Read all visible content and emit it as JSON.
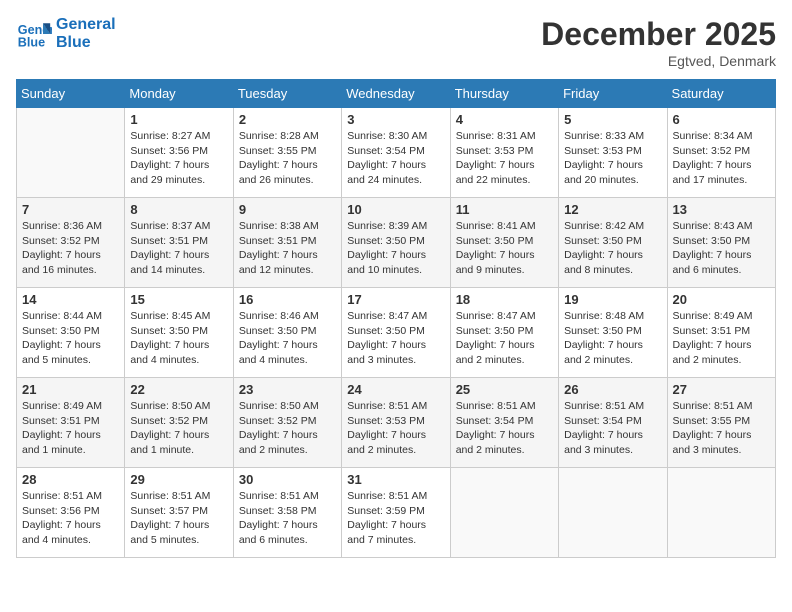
{
  "header": {
    "logo_line1": "General",
    "logo_line2": "Blue",
    "month": "December 2025",
    "location": "Egtved, Denmark"
  },
  "weekdays": [
    "Sunday",
    "Monday",
    "Tuesday",
    "Wednesday",
    "Thursday",
    "Friday",
    "Saturday"
  ],
  "weeks": [
    [
      {
        "day": "",
        "info": ""
      },
      {
        "day": "1",
        "info": "Sunrise: 8:27 AM\nSunset: 3:56 PM\nDaylight: 7 hours\nand 29 minutes."
      },
      {
        "day": "2",
        "info": "Sunrise: 8:28 AM\nSunset: 3:55 PM\nDaylight: 7 hours\nand 26 minutes."
      },
      {
        "day": "3",
        "info": "Sunrise: 8:30 AM\nSunset: 3:54 PM\nDaylight: 7 hours\nand 24 minutes."
      },
      {
        "day": "4",
        "info": "Sunrise: 8:31 AM\nSunset: 3:53 PM\nDaylight: 7 hours\nand 22 minutes."
      },
      {
        "day": "5",
        "info": "Sunrise: 8:33 AM\nSunset: 3:53 PM\nDaylight: 7 hours\nand 20 minutes."
      },
      {
        "day": "6",
        "info": "Sunrise: 8:34 AM\nSunset: 3:52 PM\nDaylight: 7 hours\nand 17 minutes."
      }
    ],
    [
      {
        "day": "7",
        "info": "Sunrise: 8:36 AM\nSunset: 3:52 PM\nDaylight: 7 hours\nand 16 minutes."
      },
      {
        "day": "8",
        "info": "Sunrise: 8:37 AM\nSunset: 3:51 PM\nDaylight: 7 hours\nand 14 minutes."
      },
      {
        "day": "9",
        "info": "Sunrise: 8:38 AM\nSunset: 3:51 PM\nDaylight: 7 hours\nand 12 minutes."
      },
      {
        "day": "10",
        "info": "Sunrise: 8:39 AM\nSunset: 3:50 PM\nDaylight: 7 hours\nand 10 minutes."
      },
      {
        "day": "11",
        "info": "Sunrise: 8:41 AM\nSunset: 3:50 PM\nDaylight: 7 hours\nand 9 minutes."
      },
      {
        "day": "12",
        "info": "Sunrise: 8:42 AM\nSunset: 3:50 PM\nDaylight: 7 hours\nand 8 minutes."
      },
      {
        "day": "13",
        "info": "Sunrise: 8:43 AM\nSunset: 3:50 PM\nDaylight: 7 hours\nand 6 minutes."
      }
    ],
    [
      {
        "day": "14",
        "info": "Sunrise: 8:44 AM\nSunset: 3:50 PM\nDaylight: 7 hours\nand 5 minutes."
      },
      {
        "day": "15",
        "info": "Sunrise: 8:45 AM\nSunset: 3:50 PM\nDaylight: 7 hours\nand 4 minutes."
      },
      {
        "day": "16",
        "info": "Sunrise: 8:46 AM\nSunset: 3:50 PM\nDaylight: 7 hours\nand 4 minutes."
      },
      {
        "day": "17",
        "info": "Sunrise: 8:47 AM\nSunset: 3:50 PM\nDaylight: 7 hours\nand 3 minutes."
      },
      {
        "day": "18",
        "info": "Sunrise: 8:47 AM\nSunset: 3:50 PM\nDaylight: 7 hours\nand 2 minutes."
      },
      {
        "day": "19",
        "info": "Sunrise: 8:48 AM\nSunset: 3:50 PM\nDaylight: 7 hours\nand 2 minutes."
      },
      {
        "day": "20",
        "info": "Sunrise: 8:49 AM\nSunset: 3:51 PM\nDaylight: 7 hours\nand 2 minutes."
      }
    ],
    [
      {
        "day": "21",
        "info": "Sunrise: 8:49 AM\nSunset: 3:51 PM\nDaylight: 7 hours\nand 1 minute."
      },
      {
        "day": "22",
        "info": "Sunrise: 8:50 AM\nSunset: 3:52 PM\nDaylight: 7 hours\nand 1 minute."
      },
      {
        "day": "23",
        "info": "Sunrise: 8:50 AM\nSunset: 3:52 PM\nDaylight: 7 hours\nand 2 minutes."
      },
      {
        "day": "24",
        "info": "Sunrise: 8:51 AM\nSunset: 3:53 PM\nDaylight: 7 hours\nand 2 minutes."
      },
      {
        "day": "25",
        "info": "Sunrise: 8:51 AM\nSunset: 3:54 PM\nDaylight: 7 hours\nand 2 minutes."
      },
      {
        "day": "26",
        "info": "Sunrise: 8:51 AM\nSunset: 3:54 PM\nDaylight: 7 hours\nand 3 minutes."
      },
      {
        "day": "27",
        "info": "Sunrise: 8:51 AM\nSunset: 3:55 PM\nDaylight: 7 hours\nand 3 minutes."
      }
    ],
    [
      {
        "day": "28",
        "info": "Sunrise: 8:51 AM\nSunset: 3:56 PM\nDaylight: 7 hours\nand 4 minutes."
      },
      {
        "day": "29",
        "info": "Sunrise: 8:51 AM\nSunset: 3:57 PM\nDaylight: 7 hours\nand 5 minutes."
      },
      {
        "day": "30",
        "info": "Sunrise: 8:51 AM\nSunset: 3:58 PM\nDaylight: 7 hours\nand 6 minutes."
      },
      {
        "day": "31",
        "info": "Sunrise: 8:51 AM\nSunset: 3:59 PM\nDaylight: 7 hours\nand 7 minutes."
      },
      {
        "day": "",
        "info": ""
      },
      {
        "day": "",
        "info": ""
      },
      {
        "day": "",
        "info": ""
      }
    ]
  ]
}
